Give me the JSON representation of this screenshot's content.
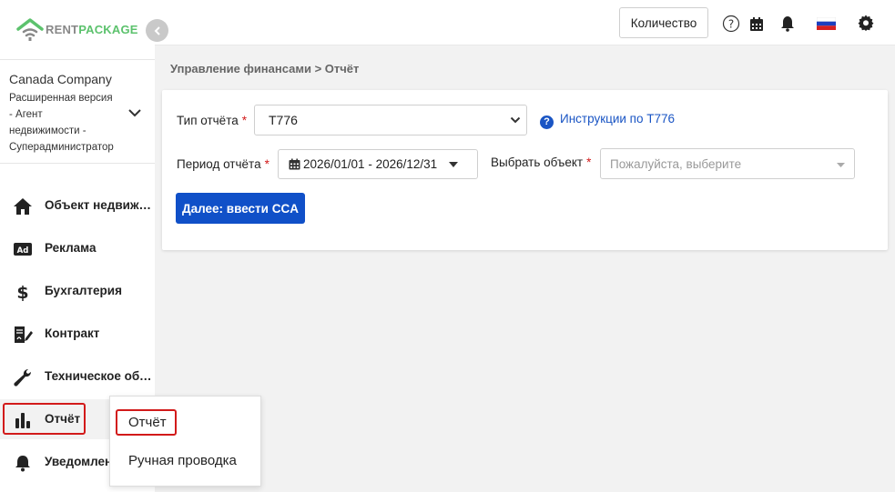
{
  "brand": {
    "part1": "RENT",
    "part2": "PACKAGE",
    "color_primary": "#5cc26d",
    "color_secondary": "#888888"
  },
  "company": {
    "name": "Canada Company",
    "role_lines": [
      "Расширенная версия",
      "- Агент",
      "недвижимости -",
      "Суперадминистратор"
    ]
  },
  "sidebar": {
    "items": [
      {
        "label": "Объект недвижимости",
        "icon": "home-icon"
      },
      {
        "label": "Реклама",
        "icon": "ad-icon"
      },
      {
        "label": "Бухгалтерия",
        "icon": "dollar-icon"
      },
      {
        "label": "Контракт",
        "icon": "contract-icon"
      },
      {
        "label": "Техническое обслуживание",
        "icon": "wrench-icon"
      },
      {
        "label": "Отчёт",
        "icon": "bar-chart-icon",
        "active": true
      },
      {
        "label": "Уведомления",
        "icon": "bell-icon"
      }
    ]
  },
  "topbar": {
    "qty_label": "Количество",
    "icons": [
      "help-icon",
      "calendar-icon",
      "bell-icon",
      "russia-flag-icon",
      "gear-icon"
    ]
  },
  "breadcrumb": "Управление финансами > Отчёт",
  "form": {
    "type_label": "Тип отчёта",
    "type_value": "T776",
    "instructions_link": "Инструкции по T776",
    "period_label": "Период отчёта",
    "period_value": "2026/01/01 - 2026/12/31",
    "object_label": "Выбрать объект",
    "object_placeholder": "Пожалуйста, выберите",
    "required_mark": "*",
    "next_label": "Далее: ввести CCA"
  },
  "dropdown": {
    "items": [
      "Отчёт",
      "Ручная проводка"
    ]
  },
  "colors": {
    "accent": "#1050c8",
    "required": "#d21a1a",
    "highlight": "#d21a1a"
  }
}
